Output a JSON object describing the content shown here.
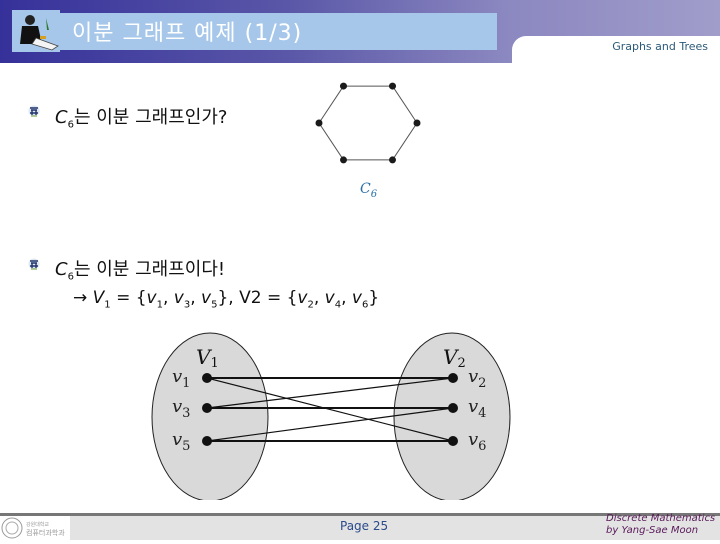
{
  "header": {
    "title": "이분 그래프 예제 (1/3)",
    "section": "Graphs and Trees"
  },
  "bullets": [
    {
      "icon": "bullet-icon",
      "var": "C",
      "sub": "6",
      "text": "는 이분 그래프인가?"
    },
    {
      "icon": "bullet-icon",
      "var": "C",
      "sub": "6",
      "text": "는 이분 그래프이다!"
    }
  ],
  "partition_line": {
    "arrow": "→",
    "v1_name": "V",
    "v1_sub": "1",
    "eq1": " = {",
    "v1_set": [
      {
        "n": "v",
        "s": "1"
      },
      {
        "n": "v",
        "s": "3"
      },
      {
        "n": "v",
        "s": "5"
      }
    ],
    "v2_label": "},  V2 = {",
    "v2_set": [
      {
        "n": "v",
        "s": "2"
      },
      {
        "n": "v",
        "s": "4"
      },
      {
        "n": "v",
        "s": "6"
      }
    ],
    "close": "}"
  },
  "c6_graph": {
    "label": "C",
    "label_sub": "6",
    "vertices": 6,
    "edges": [
      [
        0,
        1
      ],
      [
        1,
        2
      ],
      [
        2,
        3
      ],
      [
        3,
        4
      ],
      [
        4,
        5
      ],
      [
        5,
        0
      ]
    ]
  },
  "bipartite_graph": {
    "left_label": "V",
    "left_sub": "1",
    "right_label": "V",
    "right_sub": "2",
    "left_vertices": [
      "v1",
      "v3",
      "v5"
    ],
    "right_vertices": [
      "v2",
      "v4",
      "v6"
    ],
    "left_vertex_labels": [
      {
        "n": "v",
        "s": "1"
      },
      {
        "n": "v",
        "s": "3"
      },
      {
        "n": "v",
        "s": "5"
      }
    ],
    "right_vertex_labels": [
      {
        "n": "v",
        "s": "2"
      },
      {
        "n": "v",
        "s": "4"
      },
      {
        "n": "v",
        "s": "6"
      }
    ],
    "edges": [
      [
        "v1",
        "v2"
      ],
      [
        "v1",
        "v6"
      ],
      [
        "v3",
        "v2"
      ],
      [
        "v3",
        "v4"
      ],
      [
        "v5",
        "v4"
      ],
      [
        "v5",
        "v6"
      ]
    ]
  },
  "footer": {
    "page": "Page 25",
    "credit_line1": "Discrete Mathematics",
    "credit_line2": "by Yang-Sae Moon",
    "logo_text_1": "강원대학교",
    "logo_text_2": "컴퓨터과학과"
  }
}
